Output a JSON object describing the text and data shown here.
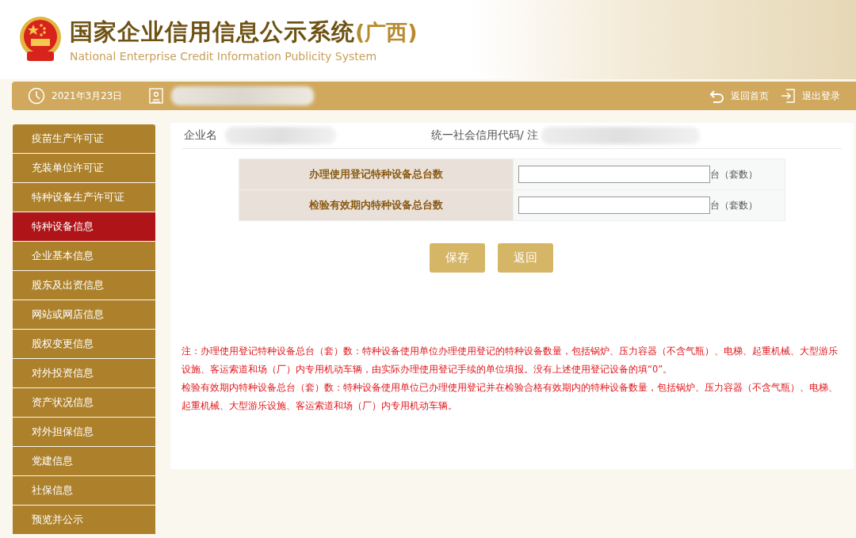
{
  "header": {
    "title": "国家企业信用信息公示系统",
    "region": "(广西)",
    "subtitle": "National Enterprise Credit Information Publicity System"
  },
  "nav_bar": {
    "date": "2021年3月23日",
    "links": [
      {
        "label": "返回首页",
        "kind": "home"
      },
      {
        "label": "退出登录",
        "kind": "logout"
      }
    ]
  },
  "sidebar": {
    "items": [
      {
        "label": "疫苗生产许可证",
        "selected": false
      },
      {
        "label": "充装单位许可证",
        "selected": false
      },
      {
        "label": "特种设备生产许可证",
        "selected": false
      },
      {
        "label": "特种设备信息",
        "selected": true
      },
      {
        "label": "企业基本信息",
        "selected": false
      },
      {
        "label": "股东及出资信息",
        "selected": false
      },
      {
        "label": "网站或网店信息",
        "selected": false
      },
      {
        "label": "股权变更信息",
        "selected": false
      },
      {
        "label": "对外投资信息",
        "selected": false
      },
      {
        "label": "资产状况信息",
        "selected": false
      },
      {
        "label": "对外担保信息",
        "selected": false
      },
      {
        "label": "党建信息",
        "selected": false
      },
      {
        "label": "社保信息",
        "selected": false
      },
      {
        "label": "预览并公示",
        "selected": false
      }
    ]
  },
  "company": {
    "name_label": "企业名",
    "code_label": "统一社会信用代码/ 注"
  },
  "form": {
    "fields": [
      {
        "label": "办理使用登记特种设备总台数",
        "unit": "台（套数）"
      },
      {
        "label": "检验有效期内特种设备总台数",
        "unit": "台（套数）"
      }
    ]
  },
  "buttons": [
    "保存",
    "返回"
  ],
  "notes": [
    "注：办理使用登记特种设备总台（套）数：特种设备使用单位办理使用登记的特种设备数量，包括锅炉、压力容器（不含气瓶）、电梯、起重机械、大型游乐设施、客运索道和场（厂）内专用机动车辆，由实际办理使用登记手续的单位填报。没有上述使用登记设备的填“0”。",
    "检验有效期内特种设备总台（套）数：特种设备使用单位已办理使用登记并在检验合格有效期内的特种设备数量，包括锅炉、压力容器（不含气瓶）、电梯、起重机械、大型游乐设施、客运索道和场（厂）内专用机动车辆。"
  ]
}
